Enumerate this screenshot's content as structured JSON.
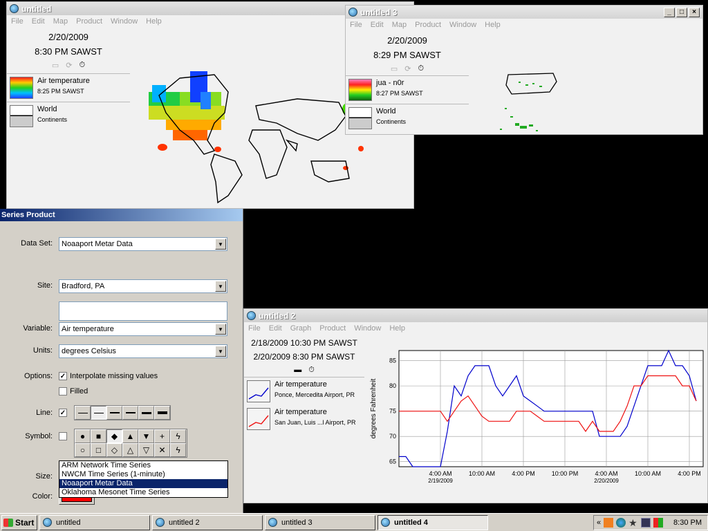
{
  "colors": {
    "series_blue": "#0000cc",
    "series_red": "#ee1111",
    "accent": "#0a246a",
    "color_swatch": "#ff0000"
  },
  "menu": [
    "File",
    "Edit",
    "Map",
    "Product",
    "Window",
    "Help"
  ],
  "graph_menu": [
    "File",
    "Edit",
    "Graph",
    "Product",
    "Window",
    "Help"
  ],
  "win1": {
    "title": "untitled",
    "date": "2/20/2009",
    "time": "8:30 PM SAWST",
    "legend": [
      {
        "title": "Air temperature",
        "sub": "8:25 PM SAWST"
      },
      {
        "title": "World",
        "sub": "Continents"
      }
    ]
  },
  "win3": {
    "title": "untitled 3",
    "date": "2/20/2009",
    "time": "8:29 PM SAWST",
    "legend": [
      {
        "title": "jua - n0r",
        "sub": "8:27 PM SAWST"
      },
      {
        "title": "World",
        "sub": "Continents"
      }
    ]
  },
  "win2": {
    "title": "untitled 2",
    "start": "2/18/2009 10:30 PM SAWST",
    "end": "2/20/2009 8:30 PM SAWST",
    "legend": [
      {
        "title": "Air temperature",
        "sub": "Ponce, Mercedita Airport, PR"
      },
      {
        "title": "Air temperature",
        "sub": "San Juan, Luis ...l Airport, PR"
      }
    ]
  },
  "dialog": {
    "title": "Series Product",
    "dataset_label": "Data Set:",
    "dataset_value": "Noaaport Metar Data",
    "dataset_options": [
      "ARM Network Time Series",
      "NWCM Time Series (1-minute)",
      "Noaaport Metar Data",
      "Oklahoma Mesonet Time Series"
    ],
    "site_label": "Site:",
    "site_value": "Bradford, PA",
    "variable_label": "Variable:",
    "variable_value": "Air temperature",
    "units_label": "Units:",
    "units_value": "degrees Celsius",
    "options_label": "Options:",
    "interpolate_label": "Interpolate missing values",
    "filled_label": "Filled",
    "line_label": "Line:",
    "symbol_label": "Symbol:",
    "size_label": "Size:",
    "color_label": "Color:"
  },
  "taskbar": {
    "start": "Start",
    "tasks": [
      "untitled",
      "untitled 2",
      "untitled 3",
      "untitled 4"
    ],
    "clock": "8:30 PM",
    "tray_chevron": "«"
  },
  "chart_data": {
    "type": "line",
    "ylabel": "degrees Fahrenheit",
    "ylim": [
      64,
      87
    ],
    "yticks": [
      65,
      70,
      75,
      80,
      85
    ],
    "xticks": [
      "4:00 AM",
      "10:00 AM",
      "4:00 PM",
      "10:00 PM",
      "4:00 AM",
      "10:00 AM",
      "4:00 PM"
    ],
    "xtick_dates": [
      "2/19/2009",
      "",
      "",
      "",
      "2/20/2009",
      "",
      ""
    ],
    "xrange_hours": [
      -2,
      42
    ],
    "xtick_hours": [
      4,
      10,
      16,
      22,
      28,
      34,
      40
    ],
    "series": [
      {
        "name": "Ponce, Mercedita Airport, PR",
        "color": "#0000cc",
        "x": [
          -2,
          -1,
          0,
          1,
          2,
          3,
          4,
          5,
          6,
          7,
          8,
          9,
          10,
          11,
          12,
          13,
          14,
          15,
          16,
          17,
          18,
          19,
          20,
          21,
          22,
          23,
          24,
          25,
          26,
          27,
          28,
          29,
          30,
          31,
          32,
          33,
          34,
          35,
          36,
          37,
          38,
          39,
          40,
          41
        ],
        "y": [
          66,
          66,
          64,
          64,
          64,
          64,
          64,
          71,
          80,
          78,
          82,
          84,
          84,
          84,
          80,
          78,
          80,
          82,
          78,
          77,
          76,
          75,
          75,
          75,
          75,
          75,
          75,
          75,
          75,
          70,
          70,
          70,
          70,
          72,
          76,
          80,
          84,
          84,
          84,
          87,
          84,
          84,
          82,
          77
        ]
      },
      {
        "name": "San Juan, Luis ...l Airport, PR",
        "color": "#ee1111",
        "x": [
          -2,
          -1,
          0,
          1,
          2,
          3,
          4,
          5,
          6,
          7,
          8,
          9,
          10,
          11,
          12,
          13,
          14,
          15,
          16,
          17,
          18,
          19,
          20,
          21,
          22,
          23,
          24,
          25,
          26,
          27,
          28,
          29,
          30,
          31,
          32,
          33,
          34,
          35,
          36,
          37,
          38,
          39,
          40,
          41
        ],
        "y": [
          75,
          75,
          75,
          75,
          75,
          75,
          75,
          73,
          75,
          77,
          78,
          76,
          74,
          73,
          73,
          73,
          73,
          75,
          75,
          75,
          74,
          73,
          73,
          73,
          73,
          73,
          73,
          71,
          73,
          71,
          71,
          71,
          73,
          76,
          80,
          80,
          82,
          82,
          82,
          82,
          82,
          80,
          80,
          77
        ]
      }
    ]
  }
}
